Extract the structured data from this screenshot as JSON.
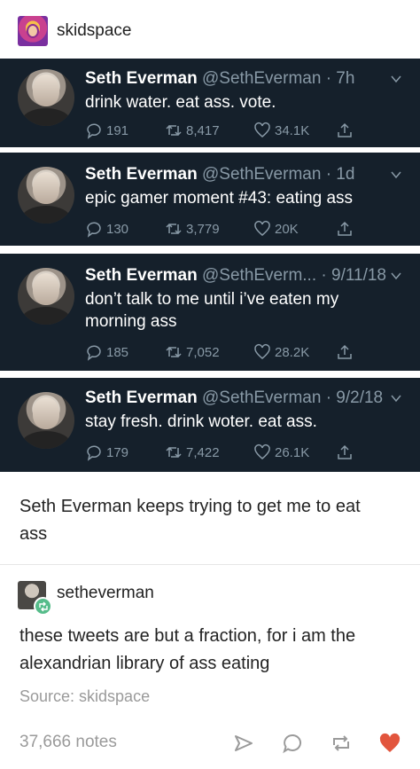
{
  "post": {
    "blog_name": "skidspace",
    "caption": "Seth Everman keeps trying to get me to eat ass"
  },
  "tweets": [
    {
      "display_name": "Seth Everman",
      "handle_time": "@SethEverman · 7h",
      "text": "drink water. eat ass. vote.",
      "replies": "191",
      "retweets": "8,417",
      "likes": "34.1K"
    },
    {
      "display_name": "Seth Everman",
      "handle_time": "@SethEverman · 1d",
      "text": "epic gamer moment #43: eating ass",
      "replies": "130",
      "retweets": "3,779",
      "likes": "20K"
    },
    {
      "display_name": "Seth Everman",
      "handle_time": "@SethEverm... · 9/11/18",
      "text": "don’t talk to me until i’ve eaten my morning ass",
      "replies": "185",
      "retweets": "7,052",
      "likes": "28.2K"
    },
    {
      "display_name": "Seth Everman",
      "handle_time": "@SethEverman · 9/2/18",
      "text": "stay fresh. drink woter. eat ass.",
      "replies": "179",
      "retweets": "7,422",
      "likes": "26.1K"
    }
  ],
  "reblog": {
    "blog_name": "setheverman",
    "text": "these tweets are but a fraction, for i am the alexandrian library of ass eating",
    "source": "Source: skidspace"
  },
  "footer": {
    "notes": "37,666 notes"
  },
  "icons": {
    "reply": "reply-icon",
    "retweet": "retweet-icon",
    "like": "heart-icon",
    "share": "share-icon",
    "more": "chevron-down-icon",
    "footer_share": "send-icon",
    "footer_reply": "comment-icon",
    "footer_reblog": "reblog-icon",
    "footer_like": "heart-icon"
  },
  "colors": {
    "tweet_background": "#15202b",
    "secondary_text": "#8899a6",
    "like_active": "#e2553d",
    "reblog_badge": "#56bc8a"
  }
}
